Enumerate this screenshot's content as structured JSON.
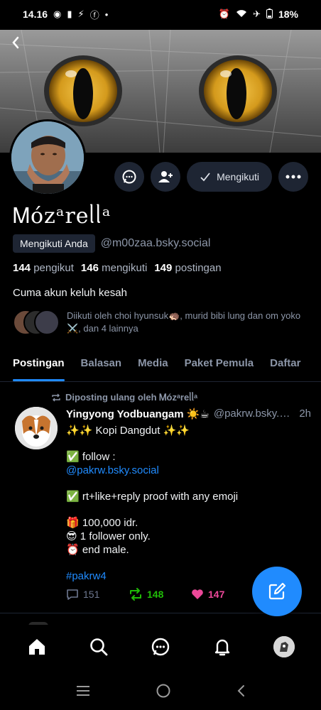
{
  "status_bar": {
    "time": "14.16",
    "battery": "18%"
  },
  "profile": {
    "display_name": "Ꮇóᴢᵃreᥣᥣᵃ",
    "follows_you_label": "Mengikuti Anda",
    "handle": "@m00zaa.bsky.social",
    "followers_count": "144",
    "followers_label": "pengikut",
    "following_count": "146",
    "following_label": "mengikuti",
    "posts_count": "149",
    "posts_label": "postingan",
    "bio": "Cuma akun keluh kesah",
    "known_followers_text": "Diikuti oleh choi hyunsuk🦔, murid bibi lung dan om yoko ⚔️, dan 4 lainnya"
  },
  "actions": {
    "following_label": "Mengikuti"
  },
  "tabs": [
    {
      "label": "Postingan",
      "active": true
    },
    {
      "label": "Balasan",
      "active": false
    },
    {
      "label": "Media",
      "active": false
    },
    {
      "label": "Paket Pemula",
      "active": false
    },
    {
      "label": "Daftar",
      "active": false
    }
  ],
  "post": {
    "repost_label": "Diposting ulang oleh Ꮇóᴢᵃreᥣᥣᵃ",
    "author_name": "Yingyong Yodbuangam ☀️☕",
    "author_handle": "@pakrw.bsky.social",
    "time": "2h",
    "line1": "✨✨ Kopi Dangdut ✨✨",
    "line2": "✅ follow :",
    "line3_link": "@pakrw.bsky.social",
    "line4": "✅ rt+like+reply proof with any emoji",
    "line5": "🎁 100,000 idr.",
    "line6": "😎 1 follower only.",
    "line7": "⏰  end male.",
    "hashtag": "#pakrw4",
    "reply_count": "151",
    "repost_count": "148",
    "like_count": "147"
  },
  "colors": {
    "accent": "#208bfe",
    "repost_active": "#20bc07",
    "like_active": "#ec4899",
    "button_bg": "#1e2533",
    "muted_text": "#8c96a8"
  },
  "icons": {
    "back": "chevron-left-icon",
    "message": "chat-bubble-icon",
    "add_user": "person-plus-icon",
    "check": "check-icon",
    "more": "ellipsis-icon",
    "compose": "pencil-square-icon",
    "home": "home-icon",
    "search": "search-icon",
    "chat": "chat-icon",
    "notifications": "bell-icon"
  }
}
